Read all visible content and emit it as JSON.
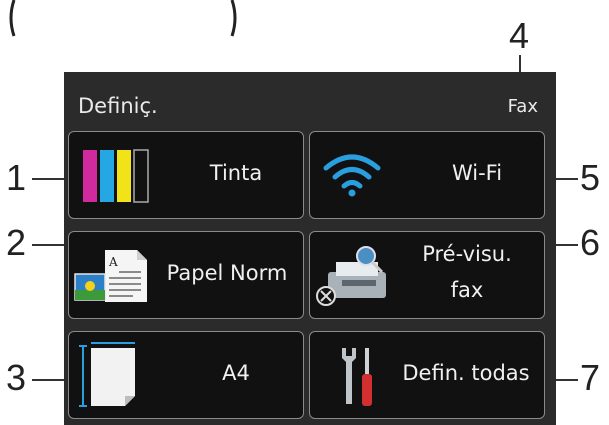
{
  "callouts": [
    "1",
    "2",
    "3",
    "4",
    "5",
    "6",
    "7"
  ],
  "screen": {
    "title": "Definiç.",
    "mode": "Fax"
  },
  "tiles": [
    {
      "label": "Tinta",
      "icon": "ink-cartridges-icon"
    },
    {
      "label": "Wi-Fi",
      "icon": "wifi-icon"
    },
    {
      "label": "Papel Norm",
      "icon": "paper-type-icon"
    },
    {
      "label_line1": "Pré-visu.",
      "label_line2": "fax",
      "icon": "fax-preview-icon"
    },
    {
      "label": "A4",
      "icon": "paper-size-icon"
    },
    {
      "label": "Defin. todas",
      "icon": "tools-icon"
    }
  ],
  "colors": {
    "screen_bg": "#2b2b2b",
    "tile_bg": "#111111",
    "tile_border": "#8a8a8a",
    "wifi": "#2a9fe0",
    "ink_magenta": "#d12a9e",
    "ink_cyan": "#25a7e3",
    "ink_yellow": "#f2e21a",
    "ink_black": "#111111"
  }
}
